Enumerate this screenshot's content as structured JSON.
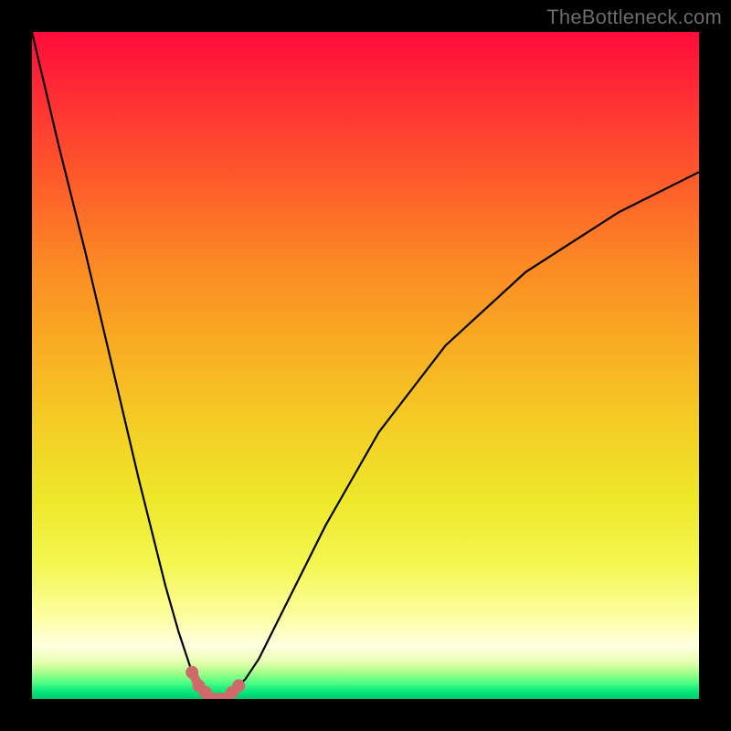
{
  "watermark": "TheBottleneck.com",
  "chart_data": {
    "type": "line",
    "title": "",
    "xlabel": "",
    "ylabel": "",
    "xlim": [
      0,
      100
    ],
    "ylim": [
      0,
      100
    ],
    "grid": false,
    "legend": false,
    "series": [
      {
        "name": "bottleneck-curve",
        "x": [
          0,
          4,
          8,
          12,
          16,
          18,
          20,
          22,
          24,
          25,
          26,
          27,
          28,
          29,
          30,
          31,
          32,
          34,
          38,
          44,
          52,
          62,
          74,
          88,
          100
        ],
        "y": [
          100,
          83,
          67,
          50,
          33,
          25,
          17,
          10,
          4,
          2,
          1,
          0,
          0,
          0,
          1,
          2,
          3,
          6,
          14,
          26,
          40,
          53,
          64,
          73,
          79
        ]
      }
    ],
    "markers": {
      "name": "minimum-highlight",
      "x": [
        24,
        25,
        26,
        27,
        28,
        29,
        30,
        31
      ],
      "y": [
        4,
        2,
        1,
        0,
        0,
        0,
        1,
        2
      ]
    },
    "background_gradient": {
      "top": "#ff0b3a",
      "mid": "#f4cb24",
      "bottom": "#00c86f"
    }
  }
}
